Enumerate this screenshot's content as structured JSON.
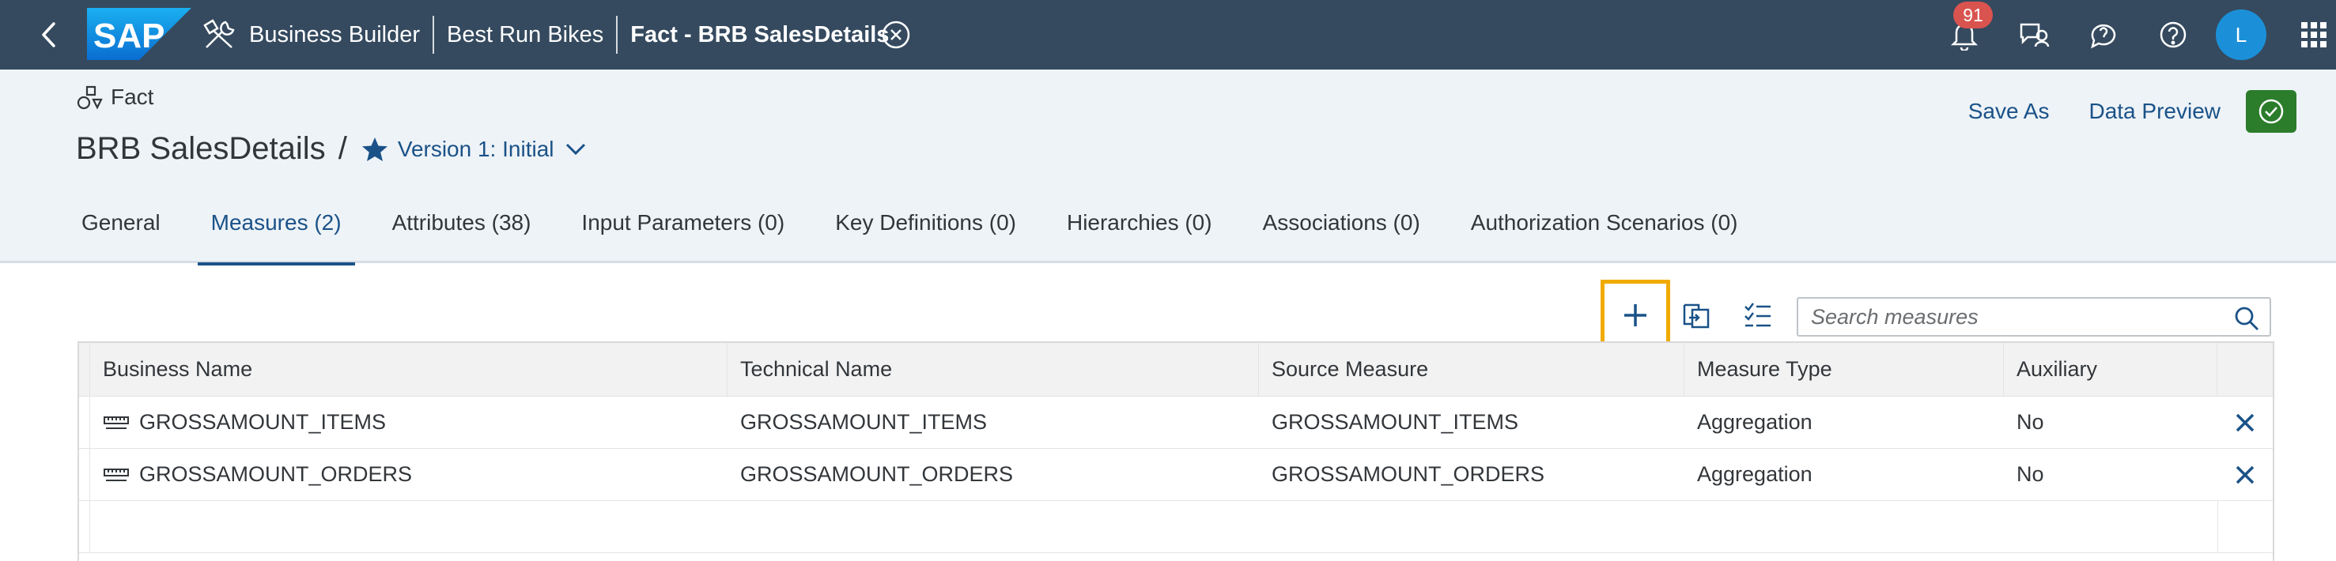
{
  "shell": {
    "logo_text": "SAP",
    "breadcrumbs": [
      "Business Builder",
      "Best Run Bikes",
      "Fact - BRB SalesDetails"
    ],
    "notification_count": "91",
    "avatar_initial": "L",
    "colors": {
      "shell_bg": "#354a5f",
      "badge": "#d9534f",
      "avatar": "#1b90d8"
    }
  },
  "header": {
    "object_type": "Fact",
    "title": "BRB SalesDetails",
    "separator": "/",
    "version": "Version 1: Initial",
    "save_as": "Save As",
    "data_preview": "Data Preview"
  },
  "tabs": [
    {
      "label": "General"
    },
    {
      "label": "Measures (2)",
      "active": true
    },
    {
      "label": "Attributes (38)"
    },
    {
      "label": "Input Parameters (0)"
    },
    {
      "label": "Key Definitions (0)"
    },
    {
      "label": "Hierarchies (0)"
    },
    {
      "label": "Associations (0)"
    },
    {
      "label": "Authorization Scenarios (0)"
    }
  ],
  "toolbar": {
    "search_placeholder": "Search measures",
    "highlight_color": "#f0ab00"
  },
  "table": {
    "columns": [
      "Business Name",
      "Technical Name",
      "Source Measure",
      "Measure Type",
      "Auxiliary"
    ],
    "rows": [
      {
        "business_name": "GROSSAMOUNT_ITEMS",
        "technical_name": "GROSSAMOUNT_ITEMS",
        "source_measure": "GROSSAMOUNT_ITEMS",
        "measure_type": "Aggregation",
        "auxiliary": "No"
      },
      {
        "business_name": "GROSSAMOUNT_ORDERS",
        "technical_name": "GROSSAMOUNT_ORDERS",
        "source_measure": "GROSSAMOUNT_ORDERS",
        "measure_type": "Aggregation",
        "auxiliary": "No"
      }
    ]
  },
  "icons": [
    "back-icon",
    "builder-icon",
    "close-circle-icon",
    "bell-icon",
    "feedback-icon",
    "chat-icon",
    "help-icon",
    "app-grid-icon",
    "fact-icon",
    "star-icon",
    "chevron-down-icon",
    "check-icon",
    "add-icon",
    "copy-icon",
    "checklist-icon",
    "search-icon",
    "measure-icon",
    "delete-icon"
  ]
}
